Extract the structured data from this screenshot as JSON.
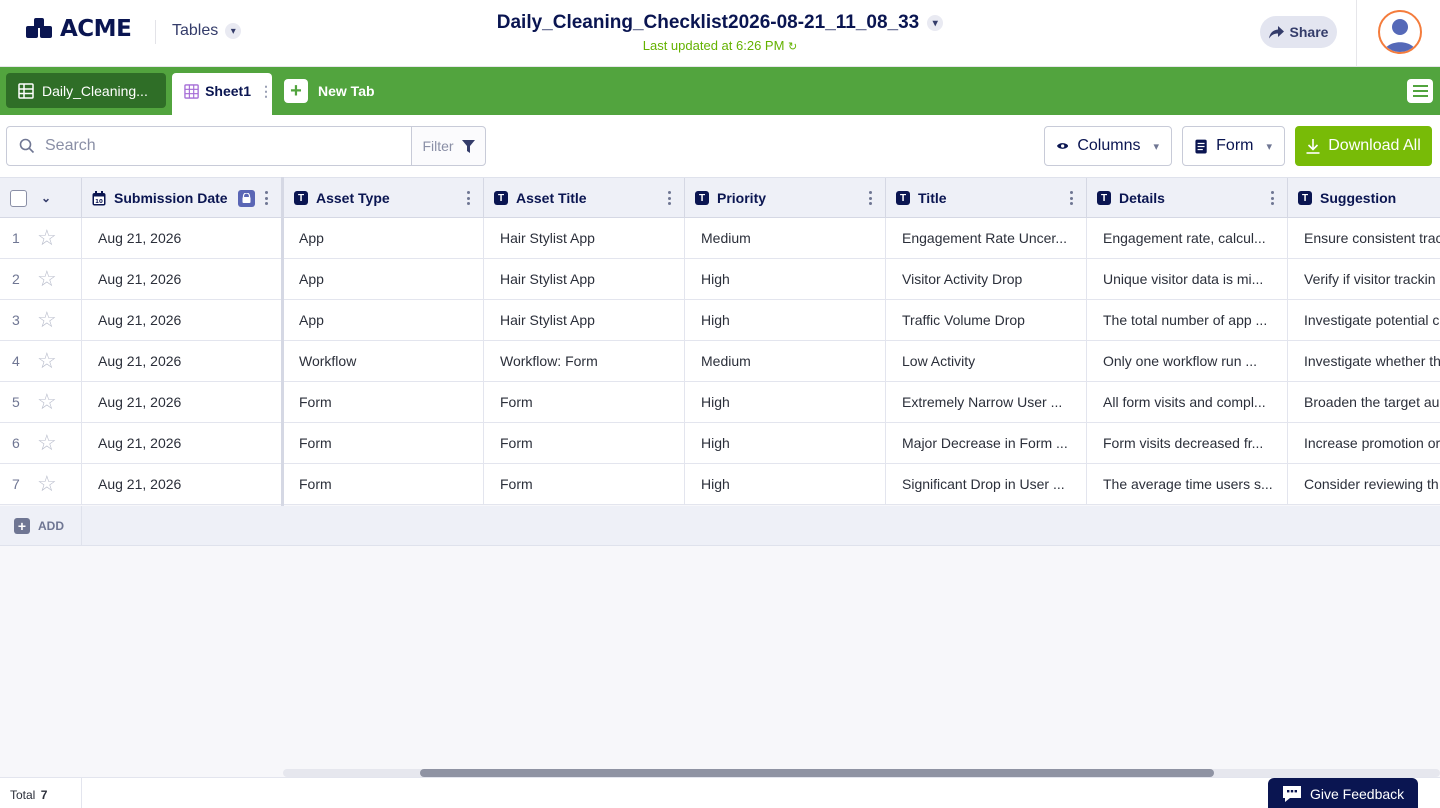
{
  "header": {
    "brand": "ACME",
    "tables_label": "Tables",
    "doc_title": "Daily_Cleaning_Checklist2026-08-21_11_08_33",
    "last_updated": "Last updated at 6:26 PM",
    "share_label": "Share"
  },
  "tabs": {
    "items": [
      {
        "label": "Daily_Cleaning...",
        "active": false
      },
      {
        "label": "Sheet1",
        "active": true
      }
    ],
    "new_tab_label": "New Tab"
  },
  "toolbar": {
    "search_placeholder": "Search",
    "filter_label": "Filter",
    "columns_label": "Columns",
    "form_label": "Form",
    "download_label": "Download All"
  },
  "table": {
    "columns": [
      "Submission Date",
      "Asset Type",
      "Asset Title",
      "Priority",
      "Title",
      "Details",
      "Suggestion"
    ],
    "rows": [
      {
        "num": "1",
        "cells": [
          "Aug 21, 2026",
          "App",
          "Hair Stylist App",
          "Medium",
          "Engagement Rate Uncer...",
          "Engagement rate, calcul...",
          "Ensure consistent trac"
        ]
      },
      {
        "num": "2",
        "cells": [
          "Aug 21, 2026",
          "App",
          "Hair Stylist App",
          "High",
          "Visitor Activity Drop",
          "Unique visitor data is mi...",
          "Verify if visitor trackin"
        ]
      },
      {
        "num": "3",
        "cells": [
          "Aug 21, 2026",
          "App",
          "Hair Stylist App",
          "High",
          "Traffic Volume Drop",
          "The total number of app ...",
          "Investigate potential c"
        ]
      },
      {
        "num": "4",
        "cells": [
          "Aug 21, 2026",
          "Workflow",
          "Workflow: Form",
          "Medium",
          "Low Activity",
          "Only one workflow run ...",
          "Investigate whether th"
        ]
      },
      {
        "num": "5",
        "cells": [
          "Aug 21, 2026",
          "Form",
          "Form",
          "High",
          "Extremely Narrow User ...",
          "All form visits and compl...",
          "Broaden the target au"
        ]
      },
      {
        "num": "6",
        "cells": [
          "Aug 21, 2026",
          "Form",
          "Form",
          "High",
          "Major Decrease in Form ...",
          "Form visits decreased fr...",
          "Increase promotion or"
        ]
      },
      {
        "num": "7",
        "cells": [
          "Aug 21, 2026",
          "Form",
          "Form",
          "High",
          "Significant Drop in User ...",
          "The average time users s...",
          "Consider reviewing th"
        ]
      }
    ],
    "add_label": "ADD"
  },
  "footer": {
    "total_label": "Total",
    "total_count": "7",
    "feedback_label": "Give Feedback"
  },
  "colors": {
    "brand": "#0a1551",
    "tabbar": "#52a43e",
    "download": "#78bb07",
    "updated_text": "#64b200",
    "avatar_ring": "#f47c3c"
  },
  "icons": [
    "grid-icon",
    "sheet-icon",
    "plus-icon",
    "menu-icon",
    "search-icon",
    "filter-icon",
    "eye-icon",
    "form-icon",
    "download-icon",
    "calendar-icon",
    "lock-icon",
    "text-type-icon",
    "star-icon",
    "share-icon",
    "feedback-icon",
    "chevron-down-icon",
    "refresh-icon"
  ]
}
